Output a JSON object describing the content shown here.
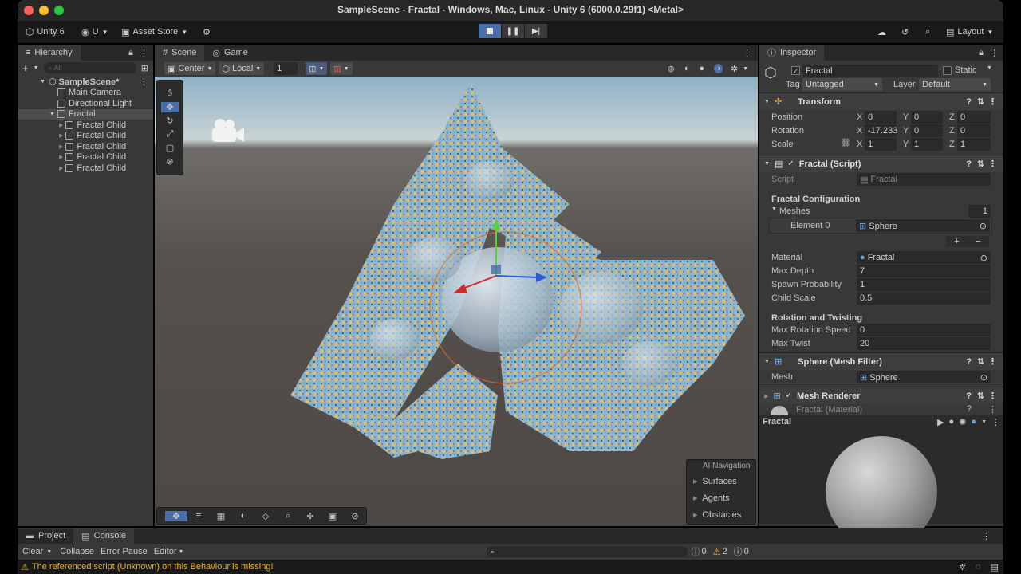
{
  "window": {
    "title": "SampleScene - Fractal - Windows, Mac, Linux - Unity 6 (6000.0.29f1) <Metal>"
  },
  "toolbar": {
    "unity_label": "Unity 6",
    "account_label": "U",
    "asset_store_label": "Asset Store",
    "layout_label": "Layout"
  },
  "hierarchy": {
    "tab_label": "Hierarchy",
    "search_placeholder": "All",
    "scene_name": "SampleScene*",
    "items": [
      "Main Camera",
      "Directional Light",
      "Fractal"
    ],
    "children": [
      "Fractal Child",
      "Fractal Child",
      "Fractal Child",
      "Fractal Child",
      "Fractal Child"
    ]
  },
  "scene": {
    "tabs": [
      "Scene",
      "Game"
    ],
    "pivot_label": "Center",
    "space_label": "Local",
    "grid_value": "1",
    "ai_nav": {
      "title": "AI Navigation",
      "items": [
        "Surfaces",
        "Agents",
        "Obstacles"
      ]
    }
  },
  "inspector": {
    "tab_label": "Inspector",
    "object_name": "Fractal",
    "static_label": "Static",
    "tag_label": "Tag",
    "tag_value": "Untagged",
    "layer_label": "Layer",
    "layer_value": "Default",
    "transform": {
      "title": "Transform",
      "position_label": "Position",
      "rotation_label": "Rotation",
      "scale_label": "Scale",
      "position": [
        "0",
        "0",
        "0"
      ],
      "rotation": [
        "-17.233",
        "0",
        "0"
      ],
      "scale": [
        "1",
        "1",
        "1"
      ]
    },
    "script": {
      "title": "Fractal (Script)",
      "script_label": "Script",
      "script_value": "Fractal",
      "config_header": "Fractal Configuration",
      "meshes_label": "Meshes",
      "meshes_count": "1",
      "element_label": "Element 0",
      "element_value": "Sphere",
      "material_label": "Material",
      "material_value": "Fractal",
      "max_depth_label": "Max Depth",
      "max_depth": "7",
      "spawn_label": "Spawn Probability",
      "spawn": "1",
      "child_scale_label": "Child Scale",
      "child_scale": "0.5",
      "rot_header": "Rotation and Twisting",
      "max_rot_label": "Max Rotation Speed",
      "max_rot": "0",
      "max_twist_label": "Max Twist",
      "max_twist": "20"
    },
    "mesh_filter": {
      "title": "Sphere (Mesh Filter)",
      "mesh_label": "Mesh",
      "mesh_value": "Sphere"
    },
    "mesh_renderer": {
      "title": "Mesh Renderer",
      "material_row": "Fractal (Material)"
    },
    "preview_label": "Fractal"
  },
  "bottom": {
    "tabs": [
      "Project",
      "Console"
    ],
    "clear_label": "Clear",
    "collapse_label": "Collapse",
    "error_pause_label": "Error Pause",
    "editor_label": "Editor",
    "log_count": "0",
    "warn_count": "2",
    "error_count": "0"
  },
  "status": {
    "message": "The referenced script (Unknown) on this Behaviour is missing!"
  }
}
